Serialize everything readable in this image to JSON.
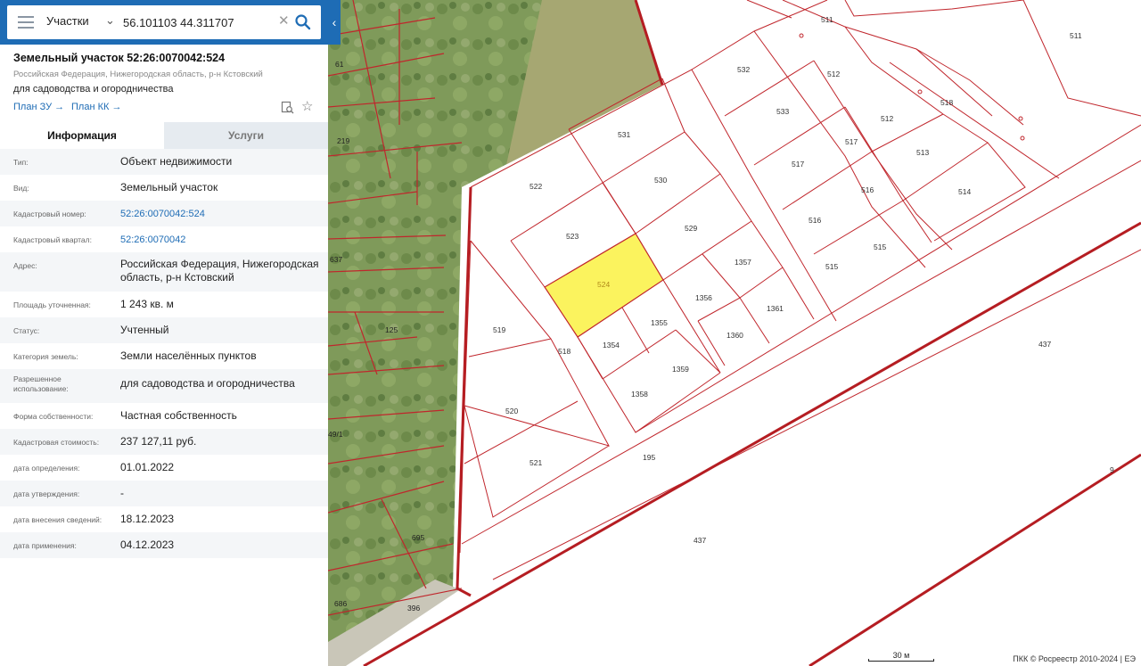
{
  "search": {
    "layer": "Участки",
    "query": "56.101103 44.311707"
  },
  "card": {
    "title": "Земельный участок 52:26:0070042:524",
    "region": "Российская Федерация, Нижегородская область, р-н Кстовский",
    "purpose": "для садоводства и огородничества",
    "plan_zu": "План ЗУ →",
    "plan_kk": "План КК →"
  },
  "tabs": {
    "info": "Информация",
    "services": "Услуги"
  },
  "info_rows": [
    {
      "label": "Тип:",
      "value": "Объект недвижимости"
    },
    {
      "label": "Вид:",
      "value": "Земельный участок"
    },
    {
      "label": "Кадастровый номер:",
      "value": "52:26:0070042:524",
      "link": true
    },
    {
      "label": "Кадастровый квартал:",
      "value": "52:26:0070042",
      "link": true
    },
    {
      "label": "Адрес:",
      "value": "Российская Федерация, Нижегородская область, р-н Кстовский"
    },
    {
      "label": "Площадь уточненная:",
      "value": "1 243 кв. м"
    },
    {
      "label": "Статус:",
      "value": "Учтенный"
    },
    {
      "label": "Категория земель:",
      "value": "Земли населённых пунктов"
    },
    {
      "label": "Разрешенное использование:",
      "value": "для садоводства и огородничества"
    },
    {
      "label": "Форма собственности:",
      "value": "Частная собственность"
    },
    {
      "label": "Кадастровая стоимость:",
      "value": "237 127,11 руб."
    },
    {
      "label": "дата определения:",
      "value": "01.01.2022"
    },
    {
      "label": "дата утверждения:",
      "value": "-"
    },
    {
      "label": "дата внесения сведений:",
      "value": "18.12.2023"
    },
    {
      "label": "дата применения:",
      "value": "04.12.2023"
    }
  ],
  "map": {
    "plot_labels": [
      "511",
      "511",
      "532",
      "512",
      "518",
      "531",
      "533",
      "512",
      "517",
      "513",
      "522",
      "530",
      "517",
      "516",
      "514",
      "523",
      "529",
      "516",
      "515",
      "1357",
      "524",
      "1356",
      "1361",
      "515",
      "519",
      "1355",
      "1360",
      "518",
      "1354",
      "1359",
      "437",
      "1358",
      "520",
      "521",
      "195",
      "9",
      "437",
      "396",
      "61",
      "219",
      "637",
      "125",
      "49/1",
      "695",
      "686"
    ],
    "highlight_color": "#fbf35e",
    "boundary_color": "#c0262c",
    "scale_label": "30 м",
    "copyright": "ПКК © Росреестр 2010-2024 | ЕЭ"
  }
}
